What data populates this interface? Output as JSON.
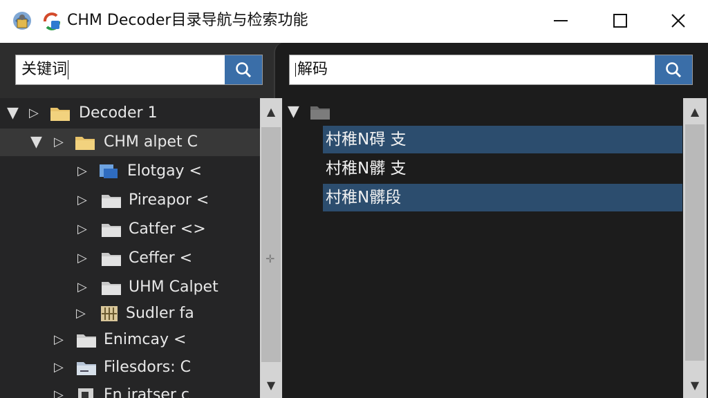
{
  "window": {
    "title": "CHM Decoder目录导航与检索功能",
    "controls": {
      "minimize": "minimize",
      "maximize": "maximize",
      "close": "close"
    }
  },
  "search_left": {
    "value": "关键词",
    "button_icon": "search-icon"
  },
  "search_right": {
    "value": "解码",
    "button_icon": "search-icon"
  },
  "tree": {
    "items": [
      {
        "label": "Decoder 1",
        "icon": "folder-icon",
        "expanded": true
      },
      {
        "label": "CHM alpet C",
        "icon": "folder-icon",
        "expanded": true,
        "selected": true
      },
      {
        "label": "Elotgay <",
        "icon": "page-icon"
      },
      {
        "label": "Pireapor <",
        "icon": "folder-icon"
      },
      {
        "label": "Catfer <>",
        "icon": "folder-icon"
      },
      {
        "label": "Ceffer <",
        "icon": "folder-icon"
      },
      {
        "label": "UHM Calpet",
        "icon": "folder-icon"
      },
      {
        "label": "Sudler fa",
        "icon": "archive-icon"
      },
      {
        "label": "Enimcay <",
        "icon": "folder-icon"
      },
      {
        "label": "Filesdors: C",
        "icon": "folder-icon"
      },
      {
        "label": "Fn iratser c",
        "icon": "folder-icon"
      }
    ]
  },
  "results": {
    "items": [
      {
        "text": "村稚N碍 支",
        "highlighted": true
      },
      {
        "text": "村稚N髒 支",
        "highlighted": false
      },
      {
        "text": "村稚N髒段",
        "highlighted": true
      }
    ]
  },
  "colors": {
    "accent": "#3a6ea8",
    "highlight": "#2c4d6e",
    "folder": "#e8c36a"
  }
}
